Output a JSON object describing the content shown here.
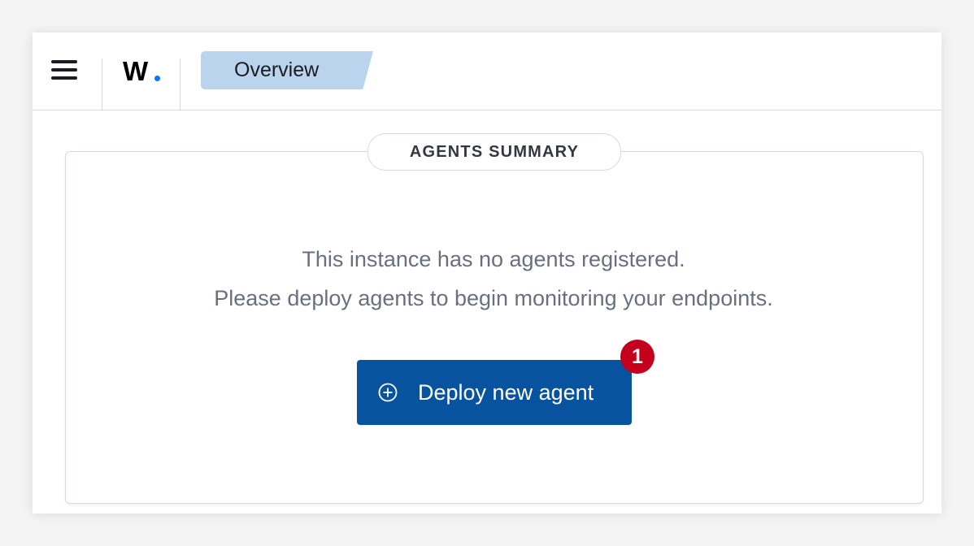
{
  "header": {
    "menu_icon": "hamburger-menu-icon",
    "logo_text": "W",
    "logo_dot_color": "#0079ff",
    "breadcrumb": "Overview"
  },
  "agents_summary": {
    "title": "AGENTS SUMMARY",
    "message_line_1": "This instance has no agents registered.",
    "message_line_2": "Please deploy agents to begin monitoring your endpoints.",
    "deploy_button_label": "Deploy new agent",
    "deploy_button_icon": "plus-circle-icon",
    "deploy_button_color": "#07539f"
  },
  "step_badge": {
    "number": "1",
    "color": "#c4001c"
  }
}
